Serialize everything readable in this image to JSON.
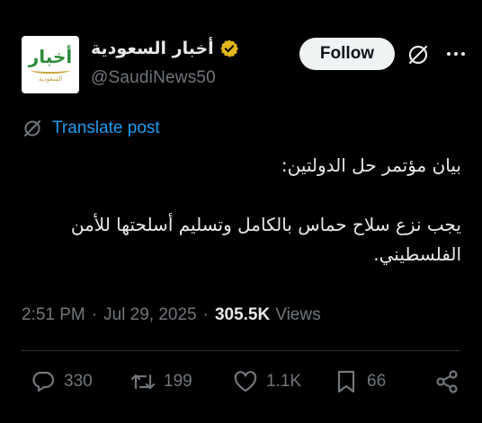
{
  "account": {
    "display_name": "أخبار السعودية",
    "handle": "@SaudiNews50",
    "avatar_text": "أخبار",
    "avatar_sub": "السعودية"
  },
  "header": {
    "follow_label": "Follow"
  },
  "translate": {
    "label": "Translate post"
  },
  "post": {
    "text": "بيان مؤتمر حل الدولتين:\n\nيجب نزع سلاح حماس بالكامل وتسليم أسلحتها للأمن الفلسطيني."
  },
  "meta": {
    "time": "2:51 PM",
    "date": "Jul 29, 2025",
    "views_count": "305.5K",
    "views_label": "Views"
  },
  "actions": {
    "replies": "330",
    "reposts": "199",
    "likes": "1.1K",
    "bookmarks": "66"
  },
  "colors": {
    "background": "#000000",
    "text": "#e7e9ea",
    "muted": "#71767b",
    "link": "#1d9bf0",
    "verified_badge": "#e2b719"
  },
  "icons": [
    "verified-badge-icon",
    "grok-icon",
    "more-icon",
    "translate-icon",
    "reply-icon",
    "repost-icon",
    "like-icon",
    "bookmark-icon",
    "share-icon"
  ]
}
